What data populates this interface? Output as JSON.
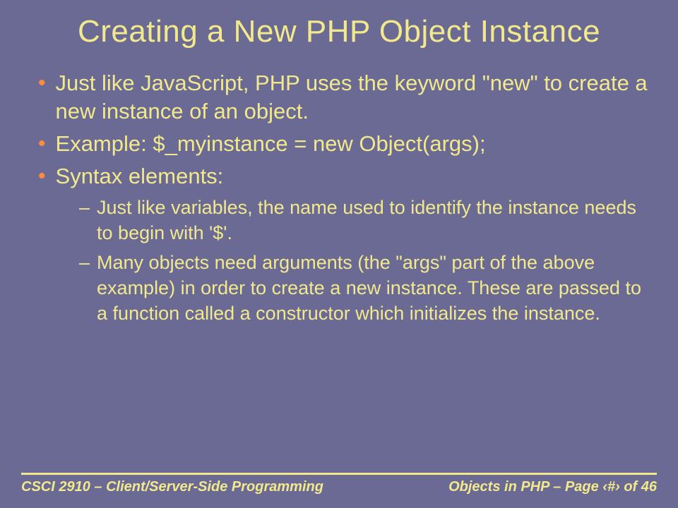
{
  "title": "Creating a New PHP Object Instance",
  "bullets": [
    {
      "text": "Just like JavaScript, PHP uses the keyword \"new\" to create a new instance of an object."
    },
    {
      "text": "Example: $_myinstance = new Object(args);"
    },
    {
      "text": "Syntax elements:"
    }
  ],
  "subs": [
    {
      "text": "Just like variables, the name used to identify the instance needs to begin with '$'."
    },
    {
      "text": "Many objects need arguments (the \"args\" part of the above example) in order to create a new instance.  These are passed to a function called a constructor which initializes the instance."
    }
  ],
  "footer": {
    "left": "CSCI 2910 – Client/Server-Side Programming",
    "right": "Objects in PHP – Page ‹#› of 46"
  }
}
